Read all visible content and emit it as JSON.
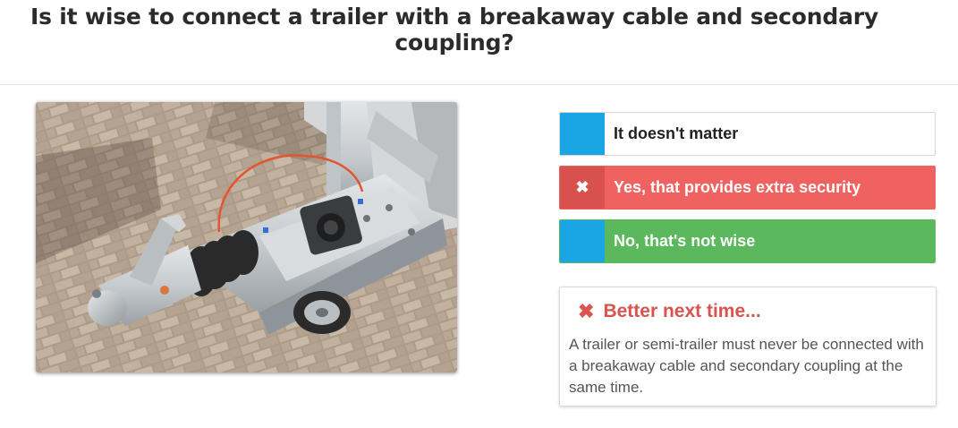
{
  "question": {
    "title": "Is it wise to connect a trailer with a breakaway cable and secondary coupling?"
  },
  "image": {
    "alt": "Trailer hitch with breakaway cable and coupling on brick pavement"
  },
  "answers": [
    {
      "tab_icon": "",
      "label": "It doesn't matter",
      "state": "neutral"
    },
    {
      "tab_icon": "✖",
      "label": "Yes, that provides extra security",
      "state": "wrong"
    },
    {
      "tab_icon": "",
      "label": "No, that's not wise",
      "state": "correct"
    }
  ],
  "feedback": {
    "icon": "✖",
    "heading": "Better next time...",
    "text": "A trailer or semi-trailer must never be connected with a breakaway cable and secondary coupling at the same time."
  },
  "colors": {
    "neutral_tab": "#1aa6e4",
    "wrong_bg": "#f0625f",
    "wrong_tab": "#d9514e",
    "correct_bg": "#5cb85c",
    "feedback_heading": "#d9534f"
  }
}
